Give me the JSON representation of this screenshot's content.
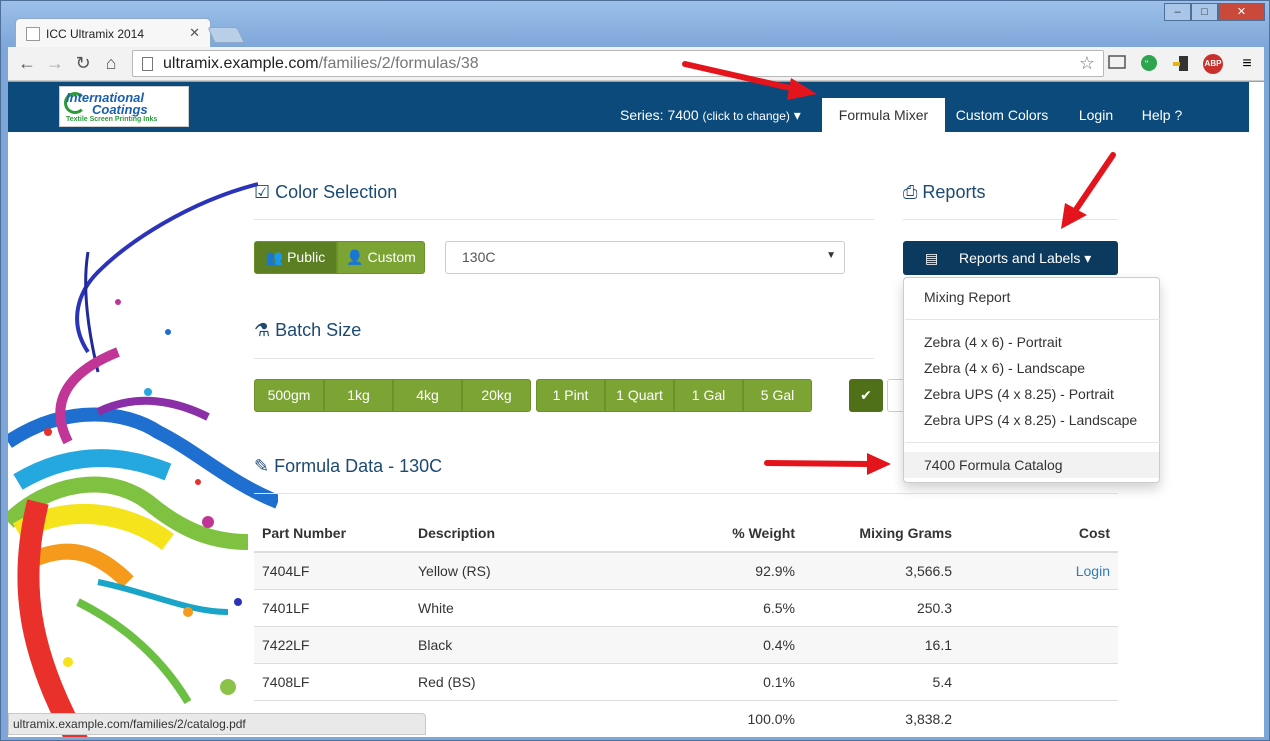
{
  "browser": {
    "tab_title": "ICC Ultramix 2014",
    "tab_close": "✕",
    "url_host": "ultramix.example.com",
    "url_path": "/families/2/formulas/38",
    "status_url": "ultramix.example.com/families/2/catalog.pdf",
    "window_controls": {
      "minimize": "–",
      "maximize": "□",
      "close": "✕"
    },
    "nav_icons": [
      "back-icon",
      "forward-icon",
      "reload-icon",
      "home-icon"
    ],
    "ext_abp": "ABP"
  },
  "logo": {
    "line1": "International",
    "line2": "Coatings",
    "tagline": "Textile Screen Printing Inks"
  },
  "nav": {
    "series_label": "Series: 7400",
    "series_hint": "(click to change)",
    "items": [
      "Formula Mixer",
      "Custom Colors",
      "Login",
      "Help ?"
    ],
    "active": "Formula Mixer",
    "color_bg": "#0b4a7b"
  },
  "color_selection": {
    "title": "Color Selection",
    "public_label": "Public",
    "custom_label": "Custom",
    "selected_color": "130C"
  },
  "reports": {
    "title": "Reports",
    "button_label": "Reports and Labels",
    "menu": [
      "Mixing Report",
      "Zebra (4 x 6) - Portrait",
      "Zebra (4 x 6) - Landscape",
      "Zebra UPS (4 x 8.25) - Portrait",
      "Zebra UPS (4 x 8.25) - Landscape",
      "7400 Formula Catalog"
    ],
    "highlighted": "7400 Formula Catalog"
  },
  "batch_size": {
    "title": "Batch Size",
    "metric": [
      "500gm",
      "1kg",
      "4kg",
      "20kg"
    ],
    "imperial": [
      "1 Pint",
      "1 Quart",
      "1 Gal",
      "5 Gal"
    ]
  },
  "formula": {
    "title": "Formula Data - 130C",
    "columns": [
      "Part Number",
      "Description",
      "% Weight",
      "Mixing Grams",
      "Cost"
    ],
    "rows": [
      [
        "7404LF",
        "Yellow (RS)",
        "92.9%",
        "3,566.5",
        "Login"
      ],
      [
        "7401LF",
        "White",
        "6.5%",
        "250.3",
        ""
      ],
      [
        "7422LF",
        "Black",
        "0.4%",
        "16.1",
        ""
      ],
      [
        "7408LF",
        "Red (BS)",
        "0.1%",
        "5.4",
        ""
      ]
    ],
    "totals": [
      "",
      "",
      "100.0%",
      "3,838.2",
      ""
    ]
  },
  "accent_colors": {
    "green": "#7ba434",
    "navy": "#0b3a5e",
    "arrow": "#e3141b"
  }
}
